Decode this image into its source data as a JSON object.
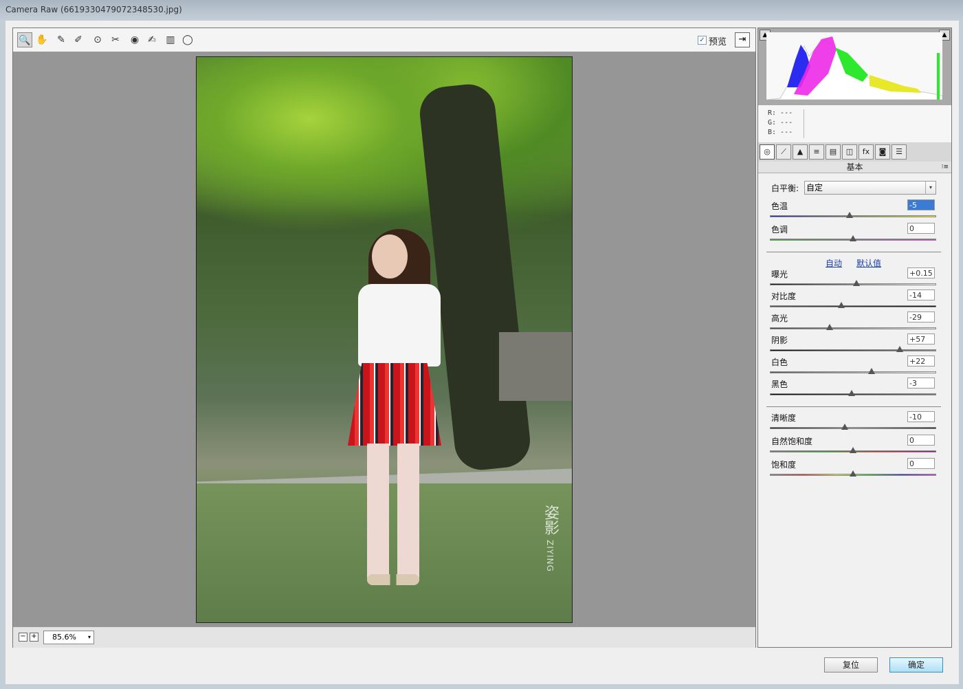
{
  "window": {
    "title": "Camera Raw (6619330479072348530.jpg)"
  },
  "toolbar": {
    "tools": [
      {
        "icon": "zoom-icon",
        "glyph": "🔍"
      },
      {
        "icon": "hand-icon",
        "glyph": "✋"
      },
      {
        "icon": "white-balance-eyedropper-icon",
        "glyph": "✎"
      },
      {
        "icon": "color-sampler-icon",
        "glyph": "✐"
      },
      {
        "icon": "targeted-adjustment-icon",
        "glyph": "⊙"
      },
      {
        "icon": "spot-removal-icon",
        "glyph": "✂"
      },
      {
        "icon": "red-eye-icon",
        "glyph": "◉"
      },
      {
        "icon": "adjustment-brush-icon",
        "glyph": "✍"
      },
      {
        "icon": "graduated-filter-icon",
        "glyph": "▥"
      },
      {
        "icon": "radial-filter-icon",
        "glyph": "◯"
      }
    ],
    "preview_label": "预览",
    "preview_checked": "✓"
  },
  "photo": {
    "watermark_main": "姿影",
    "watermark_sub": "ZIYING"
  },
  "statusbar": {
    "zoom_out": "−",
    "zoom_in": "+",
    "zoom_value": "85.6%",
    "zoom_arrow": "▾"
  },
  "readout": {
    "r": "R:  ---",
    "g": "G:  ---",
    "b": "B:  ---"
  },
  "panel_tabs": [
    {
      "icon": "basic-tab-icon",
      "glyph": "◎"
    },
    {
      "icon": "tone-curve-tab-icon",
      "glyph": "⟋"
    },
    {
      "icon": "detail-tab-icon",
      "glyph": "▲"
    },
    {
      "icon": "hsl-tab-icon",
      "glyph": "≡"
    },
    {
      "icon": "split-toning-tab-icon",
      "glyph": "▤"
    },
    {
      "icon": "lens-corrections-tab-icon",
      "glyph": "◫"
    },
    {
      "icon": "effects-tab-icon",
      "glyph": "fx"
    },
    {
      "icon": "camera-calibration-tab-icon",
      "glyph": "◙"
    },
    {
      "icon": "presets-tab-icon",
      "glyph": "☰"
    }
  ],
  "panel": {
    "title": "基本",
    "menu_glyph": "⁝≡",
    "white_balance_label": "白平衡:",
    "white_balance_value": "自定",
    "auto_link": "自动",
    "default_link": "默认值",
    "sliders": [
      {
        "label": "色温",
        "value": "-5",
        "pos": 0.48,
        "gradient": "linear-gradient(90deg,#1a2aa8,#e9e92a)",
        "selected": true
      },
      {
        "label": "色调",
        "value": "0",
        "pos": 0.5,
        "gradient": "linear-gradient(90deg,#2fb02f,#d43fd4)"
      },
      {
        "label": "曝光",
        "value": "+0.15",
        "pos": 0.52,
        "gradient": "linear-gradient(90deg,#111,#fff)"
      },
      {
        "label": "对比度",
        "value": "-14",
        "pos": 0.43,
        "gradient": "linear-gradient(90deg,#555,#111)"
      },
      {
        "label": "高光",
        "value": "-29",
        "pos": 0.36,
        "gradient": "linear-gradient(90deg,#444,#eee)"
      },
      {
        "label": "阴影",
        "value": "+57",
        "pos": 0.78,
        "gradient": "linear-gradient(90deg,#000,#888)"
      },
      {
        "label": "白色",
        "value": "+22",
        "pos": 0.61,
        "gradient": "linear-gradient(90deg,#555,#fff)"
      },
      {
        "label": "黑色",
        "value": "-3",
        "pos": 0.49,
        "gradient": "linear-gradient(90deg,#000,#777)"
      },
      {
        "label": "清晰度",
        "value": "-10",
        "pos": 0.45,
        "gradient": "linear-gradient(90deg,#222,#999,#222)"
      },
      {
        "label": "自然饱和度",
        "value": "0",
        "pos": 0.5,
        "gradient": "linear-gradient(90deg,#777,#2a2,#e22,#a0a)"
      },
      {
        "label": "饱和度",
        "value": "0",
        "pos": 0.5,
        "gradient": "linear-gradient(90deg,#888,#e33,#ee3,#3c3,#33e,#e3e)"
      }
    ]
  },
  "footer": {
    "reset_label": "复位",
    "ok_label": "确定"
  }
}
